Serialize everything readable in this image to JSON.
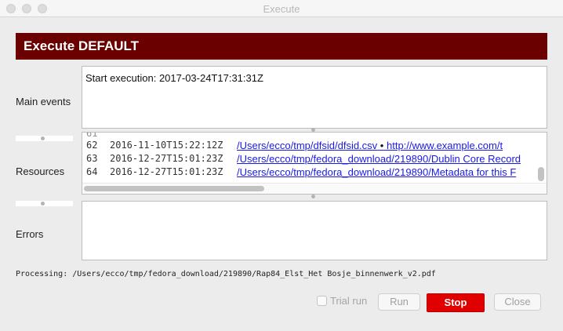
{
  "window": {
    "title": "Execute"
  },
  "header": {
    "title": "Execute DEFAULT"
  },
  "labels": {
    "main_events": "Main events",
    "resources": "Resources",
    "errors": "Errors"
  },
  "main_events": {
    "text": "Start execution: 2017-03-24T17:31:31Z"
  },
  "resources": {
    "rows": [
      {
        "num": "62",
        "timestamp": "2016-11-10T15:22:12Z",
        "path": "/Users/ecco/tmp/dfsid/dfsid.csv",
        "bullet": "•",
        "url": "http://www.example.com/t"
      },
      {
        "num": "63",
        "timestamp": "2016-12-27T15:01:23Z",
        "path": "/Users/ecco/tmp/fedora_download/219890/Dublin Core Record",
        "bullet": "",
        "url": ""
      },
      {
        "num": "64",
        "timestamp": "2016-12-27T15:01:23Z",
        "path": "/Users/ecco/tmp/fedora_download/219890/Metadata for this F",
        "bullet": "",
        "url": ""
      }
    ]
  },
  "errors": {
    "text": ""
  },
  "status": {
    "processing": "Processing: /Users/ecco/tmp/fedora_download/219890/Rap84_Elst_Het Bosje_binnenwerk_v2.pdf"
  },
  "buttons": {
    "trial_run": "Trial run",
    "run": "Run",
    "stop": "Stop",
    "close": "Close"
  },
  "colors": {
    "header_bg": "#6b0000",
    "stop_bg": "#e00000",
    "link": "#1a1ae6"
  }
}
